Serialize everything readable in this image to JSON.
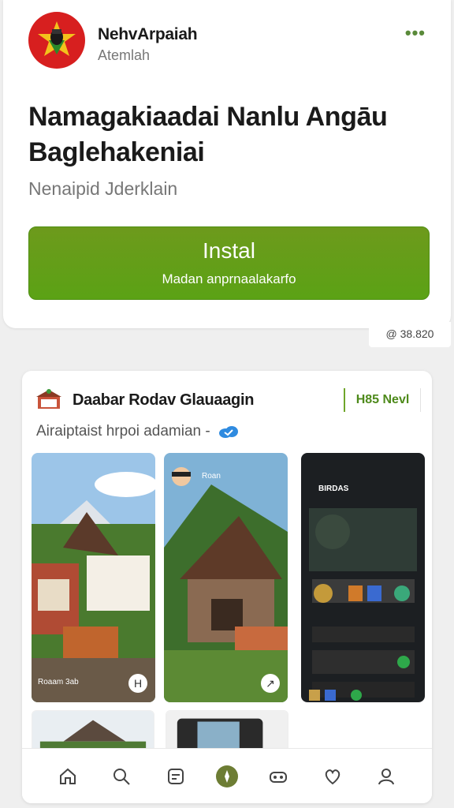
{
  "app": {
    "developer": "NehvArpaiah",
    "developer_sub": "Atemlah",
    "more_label": "•••",
    "title": "Namagakiaadai Nanlu Angāu Baglehakeniai",
    "subtitle": "Nenaipid Jderklain",
    "install_label": "Instal",
    "install_sub": "Madan anprnaalakarfo",
    "download_count": "@ 38.820"
  },
  "section": {
    "title": "Daabar Rodav Glauaagin",
    "badge": "H85 Nevl",
    "caption": "Airaiptaist hrpoi adamian -"
  },
  "screenshots": [
    {
      "label": "Roaam 3ab",
      "fab": "H"
    },
    {
      "label": "Roan",
      "fab": "↗"
    },
    {
      "label": "BIRDAS",
      "fab": ""
    }
  ],
  "nav": {
    "items": [
      "home-icon",
      "search-icon",
      "library-icon",
      "explore-icon",
      "games-icon",
      "favorites-icon",
      "profile-icon"
    ],
    "active": "explore-icon"
  },
  "colors": {
    "install_green": "#5ba215",
    "icon_red": "#d71f1f",
    "badge_green": "#4e8a1b"
  }
}
